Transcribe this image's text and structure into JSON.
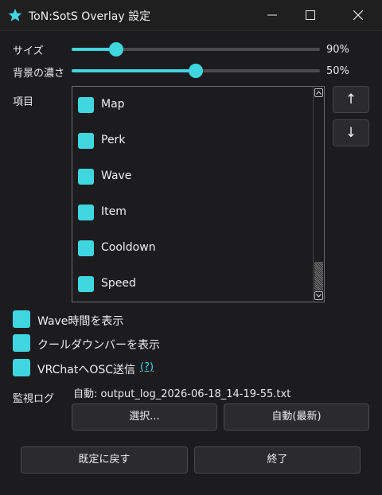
{
  "window": {
    "title": "ToN:SotS Overlay 設定"
  },
  "colors": {
    "accent": "#3fd6e0",
    "background": "#1c1c1f",
    "button": "#2b2b2e"
  },
  "settings": {
    "size": {
      "label": "サイズ",
      "value": 0.9,
      "display": "90%",
      "slider_position": 0.18
    },
    "opacity": {
      "label": "背景の濃さ",
      "value": 0.5,
      "display": "50%",
      "slider_position": 0.5
    }
  },
  "items": {
    "label": "項目",
    "list": [
      {
        "label": "Map",
        "checked": true
      },
      {
        "label": "Perk",
        "checked": true
      },
      {
        "label": "Wave",
        "checked": true
      },
      {
        "label": "Item",
        "checked": true
      },
      {
        "label": "Cooldown",
        "checked": true
      },
      {
        "label": "Speed",
        "checked": true
      }
    ],
    "move_up": "↑",
    "move_down": "↓"
  },
  "options": [
    {
      "label": "Wave時間を表示",
      "checked": true
    },
    {
      "label": "クールダウンバーを表示",
      "checked": true
    },
    {
      "label": "VRChatへOSC送信",
      "checked": true,
      "help": "(?)"
    }
  ],
  "log": {
    "label": "監視ログ",
    "path": "自動: output_log_2026-06-18_14-19-55.txt",
    "select_button": "選択...",
    "auto_button": "自動(最新)"
  },
  "footer": {
    "reset_button": "既定に戻す",
    "close_button": "終了"
  }
}
